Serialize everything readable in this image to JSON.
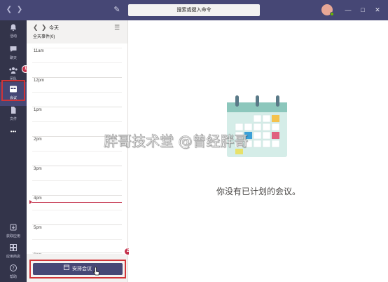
{
  "titlebar": {
    "back_icon": "chevron-left-icon",
    "forward_icon": "chevron-right-icon",
    "compose_icon": "compose-icon",
    "search_placeholder": "搜索或键入命令",
    "avatar_initial": "曾",
    "avatar_color": "#e8a796",
    "presence_color": "#6bb700"
  },
  "rail": {
    "items": [
      {
        "label": "活动",
        "icon": "bell-icon"
      },
      {
        "label": "聊天",
        "icon": "chat-icon"
      },
      {
        "label": "团队",
        "icon": "teams-icon"
      },
      {
        "label": "会议",
        "icon": "calendar-icon"
      },
      {
        "label": "文件",
        "icon": "file-icon"
      },
      {
        "label": "•••",
        "icon": "more-icon"
      }
    ],
    "bottom_items": [
      {
        "label": "获取应用",
        "icon": "download-icon"
      },
      {
        "label": "应用商店",
        "icon": "store-icon"
      },
      {
        "label": "帮助",
        "icon": "help-icon"
      }
    ],
    "active_item": "会议",
    "annotation_1": "1",
    "annotation_2": "2"
  },
  "panel": {
    "today_label": "今天",
    "all_day_label": "全天事件(0)",
    "hours": [
      "11am",
      "12pm",
      "1pm",
      "2pm",
      "3pm",
      "4pm",
      "5pm",
      "6pm"
    ],
    "schedule_button_label": "安排会议"
  },
  "main": {
    "empty_message": "你没有已计划的会议。",
    "watermark": "胖哥技术堂 @曾经胖哥"
  },
  "colors": {
    "titlebar": "#464775",
    "rail": "#33344a",
    "accent": "#464775",
    "annotation_red": "#d13438",
    "now_line": "#c4314b"
  }
}
